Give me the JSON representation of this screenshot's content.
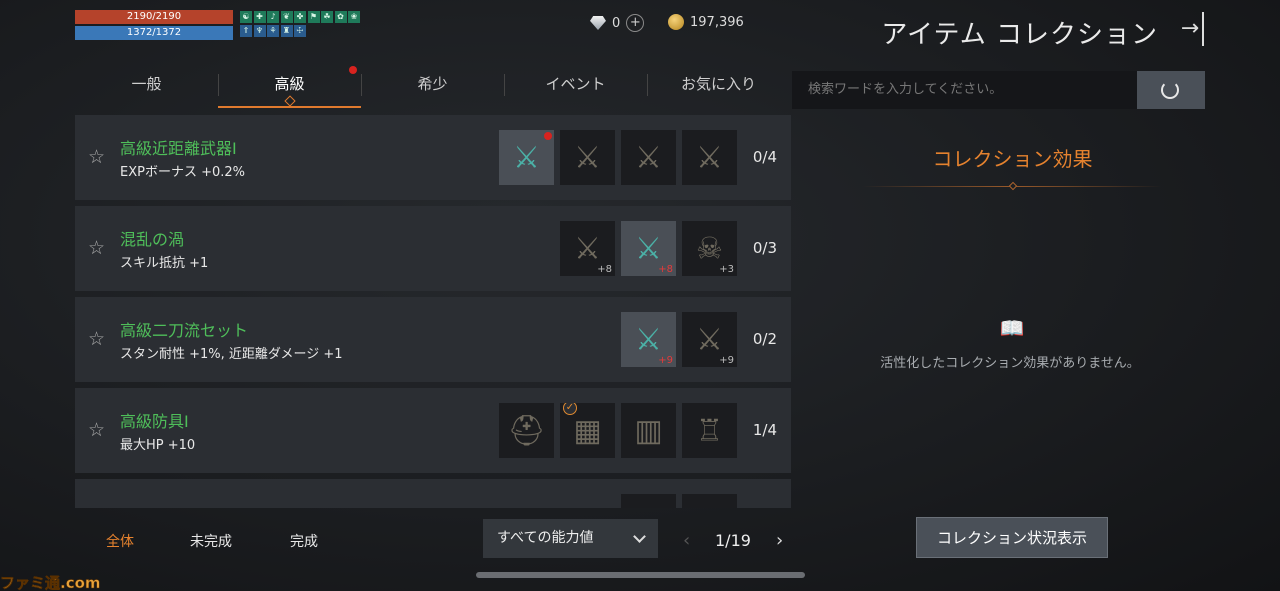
{
  "hud": {
    "hp": "2190/2190",
    "mp": "1372/1372",
    "buff_icons": [
      "☯",
      "✚",
      "♪",
      "❦",
      "✤",
      "⚑",
      "☘",
      "✿",
      "❀",
      "⇑",
      "♆",
      "⚘",
      "♜",
      "☩"
    ]
  },
  "currency": {
    "diamond": "0",
    "plus": "+",
    "gold": "197,396"
  },
  "header": {
    "title": "アイテム コレクション",
    "exit_icon": "→"
  },
  "tabs": [
    {
      "label": "一般",
      "active": false,
      "badge": false
    },
    {
      "label": "高級",
      "active": true,
      "badge": true
    },
    {
      "label": "希少",
      "active": false,
      "badge": false
    },
    {
      "label": "イベント",
      "active": false,
      "badge": false
    },
    {
      "label": "お気に入り",
      "active": false,
      "badge": false
    }
  ],
  "search": {
    "placeholder": "検索ワードを入力してください。"
  },
  "collections": [
    {
      "name": "高級近距離武器Ⅰ",
      "effect": "EXPボーナス +0.2%",
      "progress": "0/4",
      "slots": [
        {
          "icon": "crystal-claw-icon",
          "glyph": "⚔",
          "owned": true,
          "enh": "",
          "reddot": true,
          "check": false
        },
        {
          "icon": "spear-icon",
          "glyph": "⚔",
          "owned": false,
          "enh": "",
          "reddot": false,
          "check": false
        },
        {
          "icon": "axe-icon",
          "glyph": "⚔",
          "owned": false,
          "enh": "",
          "reddot": false,
          "check": false
        },
        {
          "icon": "halberd-icon",
          "glyph": "⚔",
          "owned": false,
          "enh": "",
          "reddot": false,
          "check": false
        }
      ]
    },
    {
      "name": "混乱の渦",
      "effect": "スキル抵抗 +1",
      "progress": "0/3",
      "slots": [
        {
          "icon": "dual-blades-icon",
          "glyph": "⚔",
          "owned": false,
          "enh": "+8",
          "enh_red": false,
          "reddot": false,
          "check": false
        },
        {
          "icon": "crystal-claw-icon",
          "glyph": "⚔",
          "owned": true,
          "enh": "+8",
          "enh_red": true,
          "reddot": false,
          "check": false
        },
        {
          "icon": "skull-flail-icon",
          "glyph": "☠",
          "owned": false,
          "enh": "+3",
          "enh_red": false,
          "reddot": false,
          "check": false
        }
      ]
    },
    {
      "name": "高級二刀流セット",
      "effect": "スタン耐性 +1%, 近距離ダメージ +1",
      "progress": "0/2",
      "slots": [
        {
          "icon": "crystal-claw-icon",
          "glyph": "⚔",
          "owned": true,
          "enh": "+9",
          "enh_red": true,
          "reddot": false,
          "check": false
        },
        {
          "icon": "dual-blades-icon",
          "glyph": "⚔",
          "owned": false,
          "enh": "+9",
          "enh_red": false,
          "reddot": false,
          "check": false
        }
      ]
    },
    {
      "name": "高級防具Ⅰ",
      "effect": "最大HP +10",
      "progress": "1/4",
      "slots": [
        {
          "icon": "helmet-icon",
          "glyph": "⛑",
          "owned": false,
          "enh": "",
          "reddot": false,
          "check": false
        },
        {
          "icon": "leg-armor-icon",
          "glyph": "▦",
          "owned": false,
          "enh": "",
          "reddot": false,
          "check": true
        },
        {
          "icon": "shorts-icon",
          "glyph": "▥",
          "owned": false,
          "enh": "",
          "reddot": false,
          "check": false
        },
        {
          "icon": "tunic-icon",
          "glyph": "♖",
          "owned": false,
          "enh": "",
          "reddot": false,
          "check": false
        }
      ]
    },
    {
      "name": "",
      "effect": "",
      "progress": "",
      "slots": [
        {
          "icon": "crystal-claw-icon",
          "glyph": "⚔",
          "owned": false,
          "enh": "",
          "reddot": false,
          "check": false
        },
        {
          "icon": "dual-blades-icon",
          "glyph": "⚔",
          "owned": false,
          "enh": "",
          "reddot": false,
          "check": false
        }
      ]
    }
  ],
  "filters": [
    {
      "label": "全体",
      "active": true
    },
    {
      "label": "未完成",
      "active": false
    },
    {
      "label": "完成",
      "active": false
    }
  ],
  "stat_dropdown": {
    "selected": "すべての能力値"
  },
  "pagination": {
    "current": "1/19",
    "prev": "‹",
    "next": "›"
  },
  "panel": {
    "title": "コレクション効果",
    "empty_text": "活性化したコレクション効果がありません。",
    "status_button": "コレクション状況表示"
  },
  "watermark": "ファミ通.com",
  "colors": {
    "accent": "#e5822e",
    "name_green": "#4fbf5a",
    "hp": "#b5432b",
    "mp": "#3a78b8"
  }
}
